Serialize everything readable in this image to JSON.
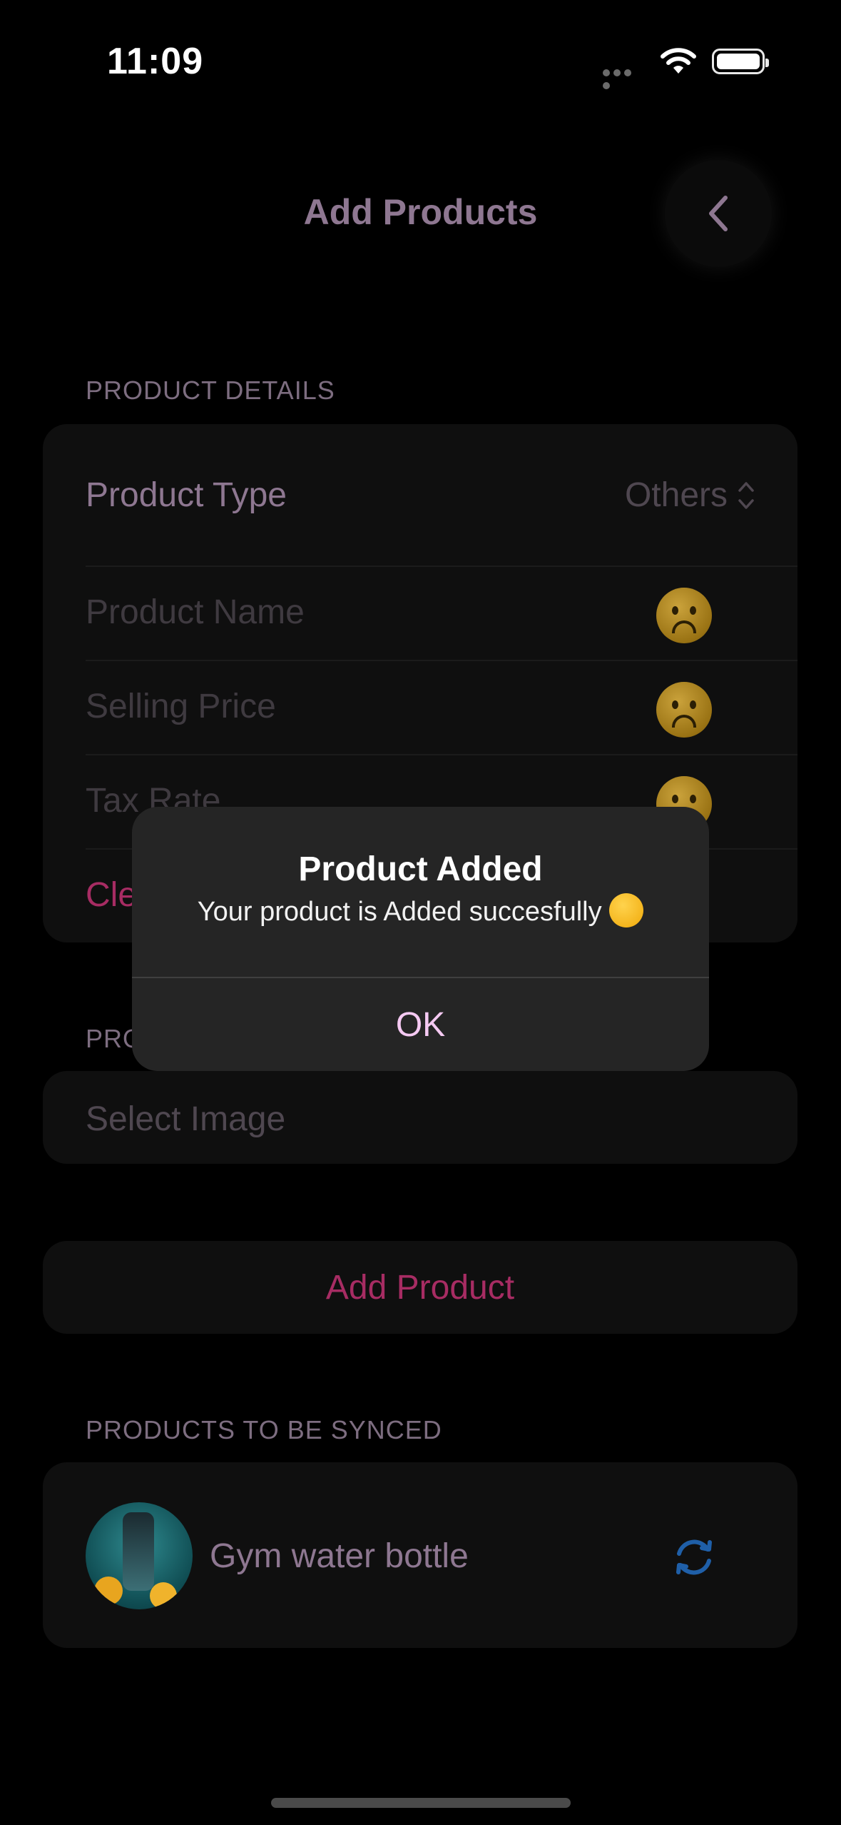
{
  "status_bar": {
    "time": "11:09"
  },
  "header": {
    "title": "Add Products"
  },
  "product_details": {
    "section_label": "PRODUCT DETAILS",
    "product_type_label": "Product Type",
    "product_type_value": "Others",
    "product_name_placeholder": "Product Name",
    "selling_price_placeholder": "Selling Price",
    "tax_rate_placeholder": "Tax Rate",
    "clear_label": "Cle"
  },
  "product_image": {
    "section_label": "PRO",
    "select_image_label": "Select Image"
  },
  "add_product_button": "Add Product",
  "sync": {
    "section_label": "PRODUCTS TO BE SYNCED",
    "items": [
      {
        "name": "Gym water bottle"
      }
    ]
  },
  "alert": {
    "title": "Product Added",
    "message": "Your product is Added succesfully",
    "ok_label": "OK"
  },
  "colors": {
    "accent_pink": "#a72c63",
    "muted_purple": "#8e7791",
    "sync_blue": "#1f5fa8"
  }
}
